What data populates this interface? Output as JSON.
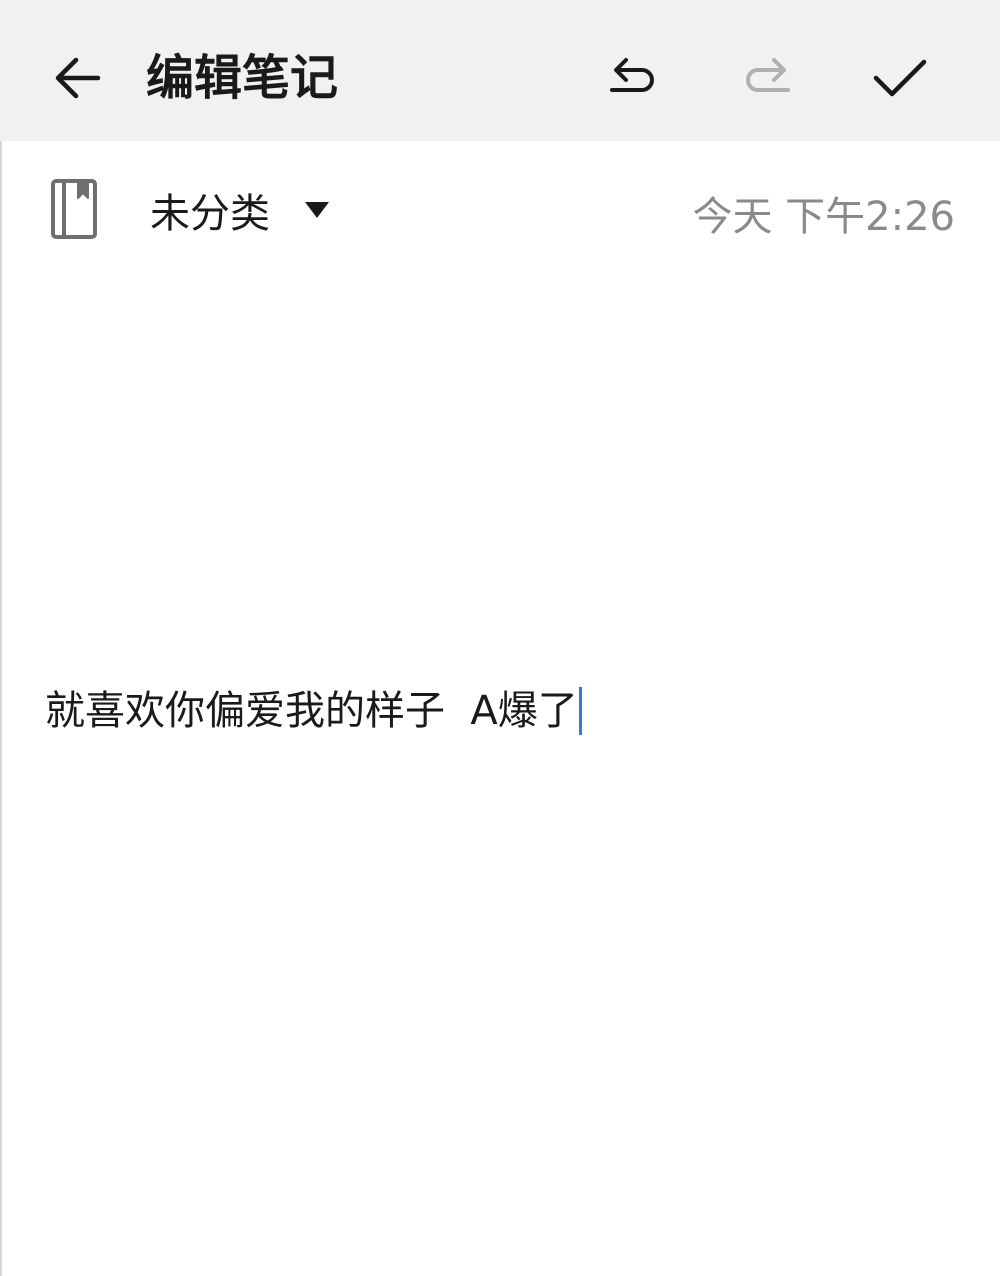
{
  "header": {
    "title": "编辑笔记",
    "back_icon": "back-arrow-icon",
    "undo_icon": "undo-icon",
    "redo_icon": "redo-icon",
    "done_icon": "checkmark-icon"
  },
  "meta": {
    "notebook_icon": "notebook-icon",
    "category": "未分类",
    "dropdown_icon": "dropdown-triangle-icon",
    "timestamp": "今天 下午2:26"
  },
  "note": {
    "content": "就喜欢你偏爱我的样子  A爆了"
  },
  "colors": {
    "topbar_bg": "#f1f1f1",
    "text": "#1a1a1a",
    "muted_text": "#8a8a8a",
    "caret": "#2a7de1",
    "disabled_icon": "#b0b0b0"
  }
}
